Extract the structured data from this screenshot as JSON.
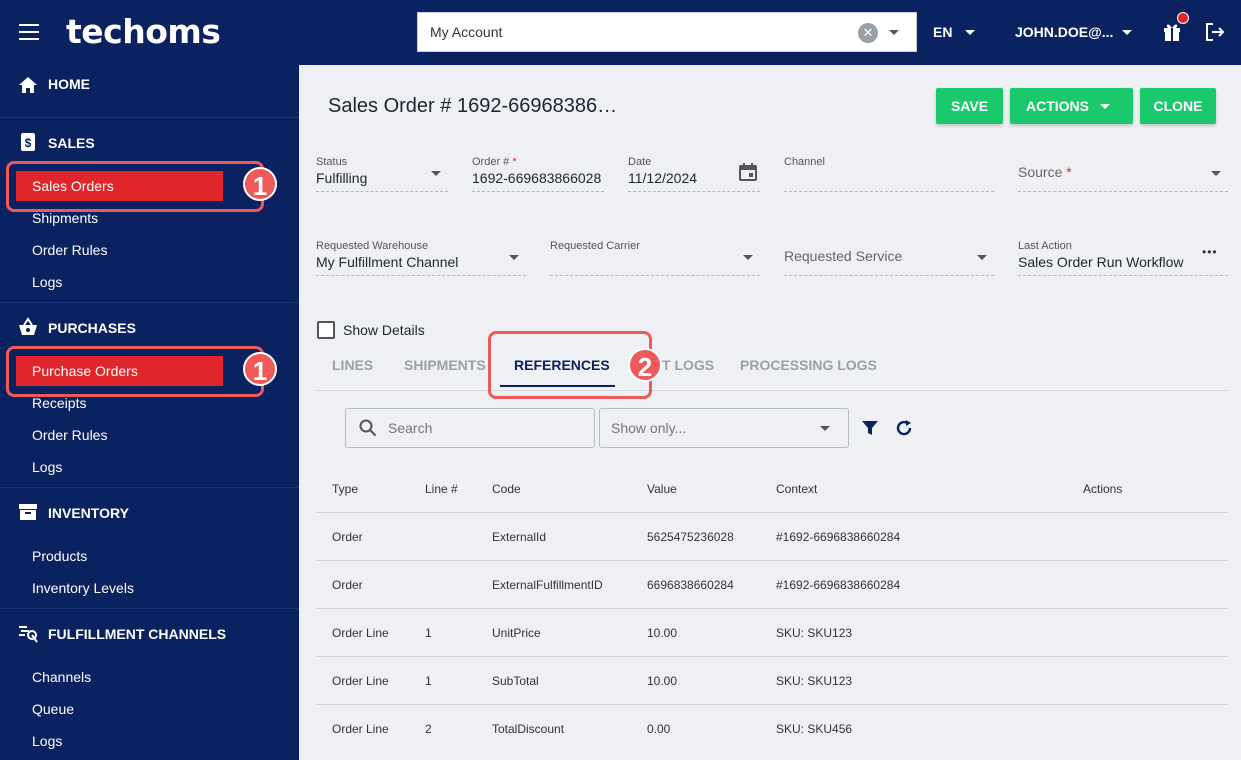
{
  "header": {
    "logo": "techoms",
    "account_value": "My Account",
    "clear_glyph": "✕",
    "language": "EN",
    "user": "JOHN.DOE@..."
  },
  "sidebar": {
    "sections": {
      "home": "HOME",
      "sales": "SALES",
      "purchases": "PURCHASES",
      "inventory": "INVENTORY",
      "fulfillment": "FULFILLMENT CHANNELS"
    },
    "sales_items": [
      "Sales Orders",
      "Shipments",
      "Order Rules",
      "Logs"
    ],
    "purchase_items": [
      "Purchase Orders",
      "Receipts",
      "Order Rules",
      "Logs"
    ],
    "inventory_items": [
      "Products",
      "Inventory Levels"
    ],
    "fulfillment_items": [
      "Channels",
      "Queue",
      "Logs"
    ],
    "callout_1": "1",
    "callout_2": "2"
  },
  "page": {
    "title": "Sales Order # 1692-66968386…",
    "buttons": {
      "save": "SAVE",
      "actions": "ACTIONS",
      "clone": "CLONE"
    }
  },
  "form": {
    "status": {
      "label": "Status",
      "value": "Fulfilling"
    },
    "order_no": {
      "label": "Order #",
      "required": "*",
      "value": "1692-669683866028"
    },
    "date": {
      "label": "Date",
      "value": "11/12/2024"
    },
    "channel": {
      "label": "Channel",
      "value": ""
    },
    "source": {
      "label": "Source",
      "required": "*"
    },
    "requested_warehouse": {
      "label": "Requested Warehouse",
      "value": "My Fulfillment Channel"
    },
    "requested_carrier": {
      "label": "Requested Carrier",
      "value": ""
    },
    "requested_service": {
      "label": "Requested Service"
    },
    "last_action": {
      "label": "Last Action",
      "value": "Sales Order Run Workflow",
      "more": "•••"
    },
    "show_details": "Show Details"
  },
  "tabs": [
    "LINES",
    "SHIPMENTS",
    "REFERENCES",
    "AUDIT LOGS",
    "PROCESSING LOGS"
  ],
  "tabs_visible": {
    "audit_fragment": "T LOGS"
  },
  "active_tab": "REFERENCES",
  "toolbar": {
    "search_placeholder": "Search",
    "show_only_placeholder": "Show only..."
  },
  "table": {
    "columns": [
      "Type",
      "Line #",
      "Code",
      "Value",
      "Context",
      "Actions"
    ],
    "rows": [
      {
        "type": "Order",
        "line": "",
        "code": "ExternalId",
        "value": "5625475236028",
        "context": "#1692-6696838660284"
      },
      {
        "type": "Order",
        "line": "",
        "code": "ExternalFulfillmentID",
        "value": "6696838660284",
        "context": "#1692-6696838660284"
      },
      {
        "type": "Order Line",
        "line": "1",
        "code": "UnitPrice",
        "value": "10.00",
        "context": "SKU: SKU123"
      },
      {
        "type": "Order Line",
        "line": "1",
        "code": "SubTotal",
        "value": "10.00",
        "context": "SKU: SKU123"
      },
      {
        "type": "Order Line",
        "line": "2",
        "code": "TotalDiscount",
        "value": "0.00",
        "context": "SKU: SKU456"
      }
    ]
  },
  "colors": {
    "navy": "#0b2261",
    "green": "#1ac96b",
    "red": "#e1262b",
    "callout": "#ee5a5a"
  }
}
